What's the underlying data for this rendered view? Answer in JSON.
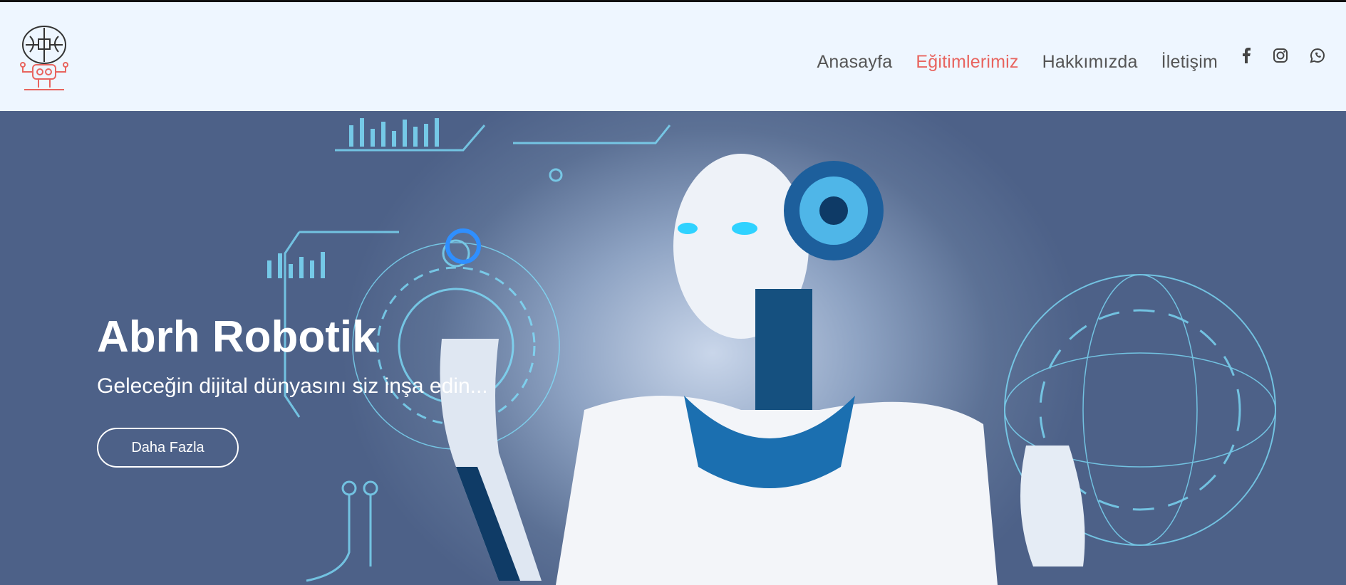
{
  "header": {
    "logo_icon": "robot-brain-logo-icon",
    "nav": [
      {
        "label": "Anasayfa",
        "active": false
      },
      {
        "label": "Eğitimlerimiz",
        "active": true
      },
      {
        "label": "Hakkımızda",
        "active": false
      },
      {
        "label": "İletişim",
        "active": false
      }
    ],
    "social_icons": [
      "facebook-icon",
      "instagram-icon",
      "whatsapp-icon"
    ],
    "accent_color": "#e8645f"
  },
  "hero": {
    "title": "Abrh Robotik",
    "subtitle": "Geleceğin dijital dünyasını siz inşa edin...",
    "button_label": "Daha Fazla",
    "background": "humanoid-robot-hologram-image"
  }
}
